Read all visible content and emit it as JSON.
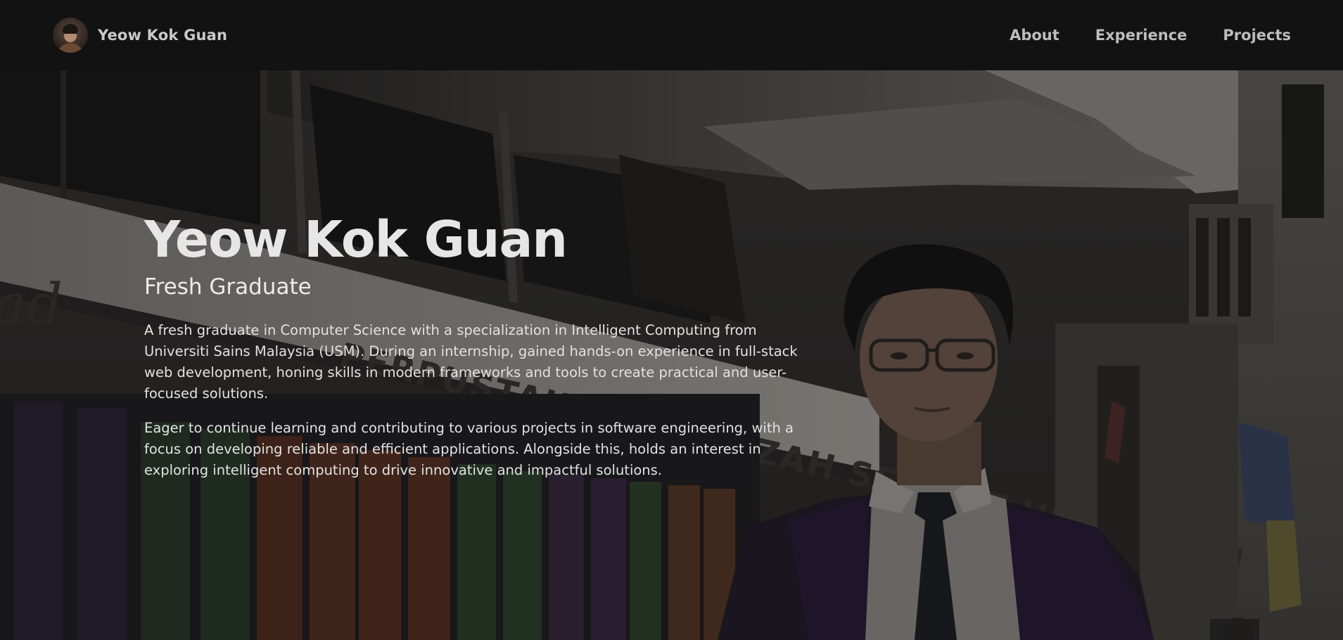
{
  "navbar": {
    "brand_name": "Yeow Kok Guan",
    "links": [
      {
        "label": "About"
      },
      {
        "label": "Experience"
      },
      {
        "label": "Projects"
      }
    ]
  },
  "hero": {
    "title": "Yeow Kok Guan",
    "subtitle": "Fresh Graduate",
    "paragraphs": [
      "A fresh graduate in Computer Science with a specialization in Intelligent Computing from Universiti Sains Malaysia (USM). During an internship, gained hands-on experience in full-stack web development, honing skills in modern frameworks and tools to create practical and user-focused solutions.",
      "Eager to continue learning and contributing to various projects in software engineering, with a focus on developing reliable and efficient applications. Alongside this, holds an interest in exploring intelligent computing to drive innovative and impactful solutions."
    ],
    "background_image_text": "PERPUSTAKAAN HAMZAH SENDUT UNIVERSITI"
  },
  "colors": {
    "navbar_bg": "#121212",
    "nav_text": "#bdbdbd",
    "hero_text": "#e6e6e6",
    "overlay": "rgba(12,12,12,0.38)"
  },
  "icons": {
    "avatar": "profile-photo-avatar"
  }
}
